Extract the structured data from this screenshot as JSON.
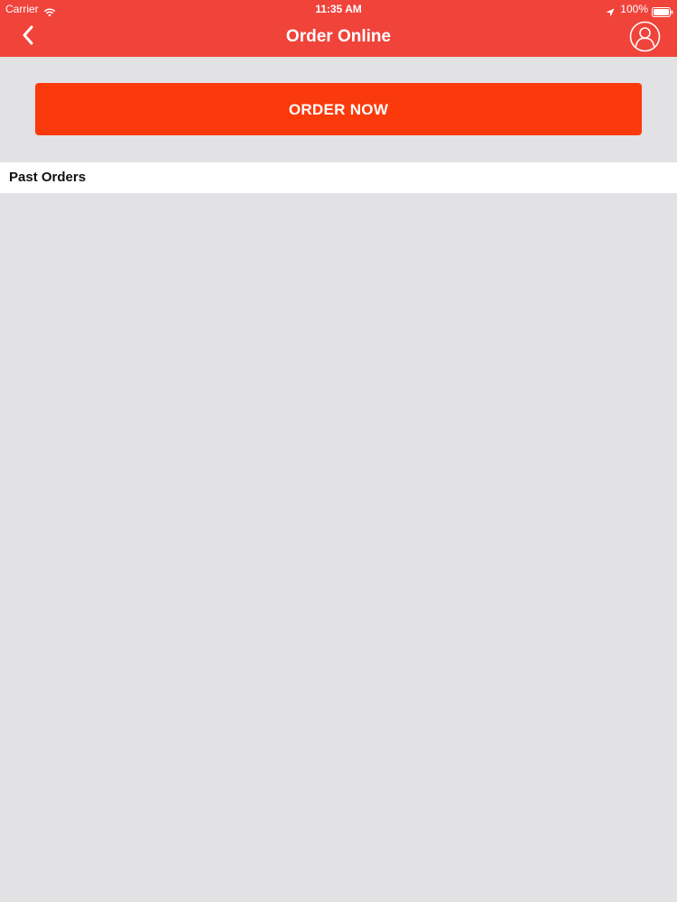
{
  "status_bar": {
    "carrier": "Carrier",
    "time": "11:35 AM",
    "battery": "100%"
  },
  "nav": {
    "title": "Order Online",
    "back_icon": "chevron-left-icon",
    "profile_icon": "user-icon"
  },
  "order": {
    "button_label": "ORDER NOW"
  },
  "past_orders": {
    "title": "Past Orders",
    "items": []
  },
  "colors": {
    "header_bg": "#f0433a",
    "button_bg": "#fb3a0c",
    "page_bg": "#e2e1e3"
  }
}
